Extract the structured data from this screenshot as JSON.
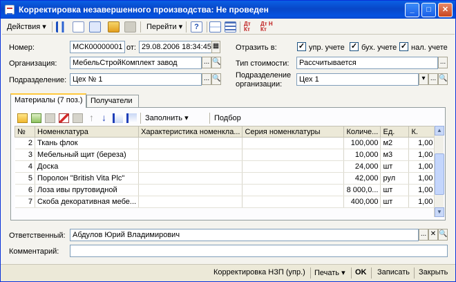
{
  "window": {
    "title": "Корректировка незавершенного производства: Не проведен",
    "buttons": {
      "minimize": "_",
      "maximize": "□",
      "close": "✕"
    }
  },
  "toolbar": {
    "actions_label": "Действия",
    "goto_label": "Перейти",
    "help_label": "?",
    "dt_kt_label": "Дт Кт",
    "dtn_kt_label": "Дт Н Кт",
    "dropdown_arrow": "▾"
  },
  "form": {
    "number_label": "Номер:",
    "number_value": "МСК00000001",
    "date_label": "от:",
    "date_value": "29.08.2006 18:34:45",
    "organization_label": "Организация:",
    "organization_value": "МебельСтройКомплект завод",
    "department_label": "Подразделение:",
    "department_value": "Цех № 1",
    "reflect_label": "Отразить в:",
    "reflect_options": [
      {
        "label": "упр. учете",
        "checked": true
      },
      {
        "label": "бух. учете",
        "checked": true
      },
      {
        "label": "нал. учете",
        "checked": true
      }
    ],
    "cost_type_label": "Тип стоимости:",
    "cost_type_value": "Рассчитывается",
    "org_department_label_1": "Подразделение",
    "org_department_label_2": "организации:",
    "org_department_value": "Цех 1",
    "ellipsis": "...",
    "check_mark": "✓"
  },
  "tabs": [
    {
      "label": "Материалы (7 поз.)",
      "active": true
    },
    {
      "label": "Получатели",
      "active": false
    }
  ],
  "grid_toolbar": {
    "fill_label": "Заполнить",
    "select_label": "Подбор",
    "up_arrow": "↑",
    "down_arrow": "↓"
  },
  "grid": {
    "columns": [
      "№",
      "Номенклатура",
      "Характеристика номенкла...",
      "Серия номенклатуры",
      "Количе...",
      "Ед.",
      "К."
    ],
    "rows": [
      {
        "n": "2",
        "name": "Ткань флок",
        "char": "",
        "series": "",
        "qty": "100,000",
        "unit": "м2",
        "k": "1,00"
      },
      {
        "n": "3",
        "name": "Мебельный щит (береза)",
        "char": "",
        "series": "",
        "qty": "10,000",
        "unit": "м3",
        "k": "1,00"
      },
      {
        "n": "4",
        "name": "Доска",
        "char": "",
        "series": "",
        "qty": "24,000",
        "unit": "шт",
        "k": "1,00"
      },
      {
        "n": "5",
        "name": "Поролон \"British Vita Plc\"",
        "char": "",
        "series": "",
        "qty": "42,000",
        "unit": "рул",
        "k": "1,00"
      },
      {
        "n": "6",
        "name": "Лоза ивы прутовидной",
        "char": "",
        "series": "",
        "qty": "8 000,0...",
        "unit": "шт",
        "k": "1,00"
      },
      {
        "n": "7",
        "name": "Скоба декоративная мебе...",
        "char": "",
        "series": "",
        "qty": "400,000",
        "unit": "шт",
        "k": "1,00"
      }
    ]
  },
  "footer": {
    "responsible_label": "Ответственный:",
    "responsible_value": "Абдулов Юрий Владимирович",
    "comment_label": "Комментарий:",
    "comment_value": ""
  },
  "statusbar": {
    "report_label": "Корректировка НЗП (упр.)",
    "print_label": "Печать",
    "ok_label": "OK",
    "save_label": "Записать",
    "close_label": "Закрыть"
  },
  "colors": {
    "title_blue": "#0a5fe4",
    "tab_highlight": "#ffc83c",
    "field_border": "#7f9db9"
  }
}
